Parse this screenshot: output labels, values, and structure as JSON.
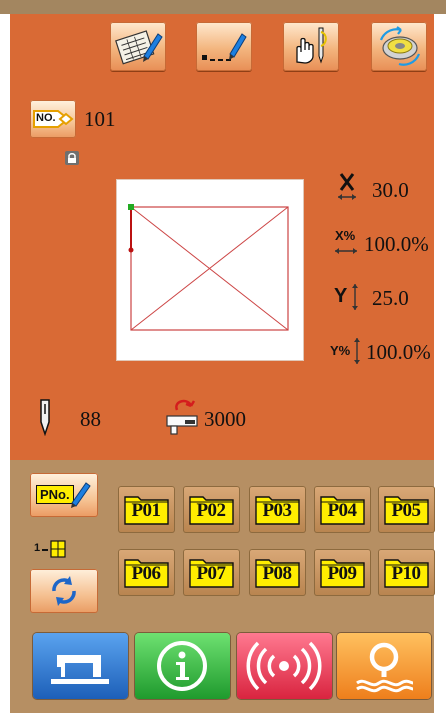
{
  "toolbar": {
    "buttons": [
      {
        "name": "pattern-edit-button",
        "icon": "checklist-pen-icon"
      },
      {
        "name": "stitch-program-button",
        "icon": "dashed-line-pen-icon"
      },
      {
        "name": "needle-touch-button",
        "icon": "hand-needle-icon"
      },
      {
        "name": "bobbin-wind-button",
        "icon": "bobbin-icon"
      }
    ]
  },
  "pattern": {
    "no_label": "NO.",
    "number": "101"
  },
  "scale": {
    "x_value": "30.0",
    "x_percent_label": "X%",
    "x_percent": "100.0%",
    "y_label": "Y",
    "y_value": "25.0",
    "y_percent_label": "Y%",
    "y_percent": "100.0%"
  },
  "counters": {
    "needle_value": "88",
    "stitch_count": "3000"
  },
  "pno": {
    "label": "PNo.",
    "page_indicator": "1"
  },
  "programs": [
    "P01",
    "P02",
    "P03",
    "P04",
    "P05",
    "P06",
    "P07",
    "P08",
    "P09",
    "P10"
  ],
  "colors": {
    "main_panel": "#d96a35",
    "bottom_panel": "#b68f63",
    "folder_yellow": "#ffee00",
    "blue_button": "#2b73c9",
    "green_button": "#30b53c",
    "red_button": "#e03a55",
    "orange_button": "#f08a2e"
  }
}
